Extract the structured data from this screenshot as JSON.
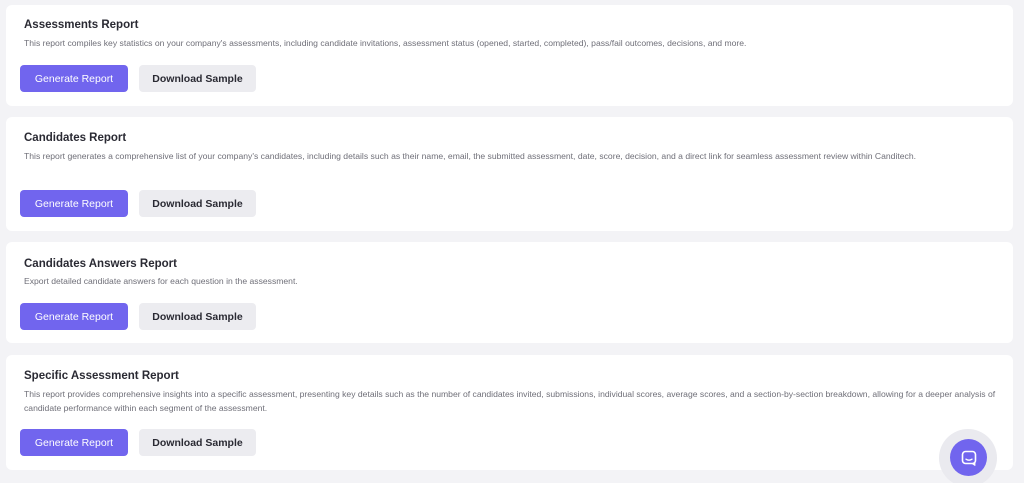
{
  "reports": [
    {
      "title": "Assessments Report",
      "description": "This report compiles key statistics on your company's assessments, including candidate invitations, assessment status (opened, started, completed), pass/fail outcomes, decisions, and more.",
      "generate_label": "Generate Report",
      "download_label": "Download Sample"
    },
    {
      "title": "Candidates Report",
      "description": "This report generates a comprehensive list of your company's candidates, including details such as their name, email, the submitted assessment, date, score, decision, and a direct link for seamless assessment review within Canditech.",
      "generate_label": "Generate Report",
      "download_label": "Download Sample"
    },
    {
      "title": "Candidates Answers Report",
      "description": "Export detailed candidate answers for each question in the assessment.",
      "generate_label": "Generate Report",
      "download_label": "Download Sample"
    },
    {
      "title": "Specific Assessment Report",
      "description": "This report provides comprehensive insights into a specific assessment, presenting key details such as the number of candidates invited, submissions, individual scores, average scores, and a section-by-section breakdown, allowing for a deeper analysis of candidate performance within each segment of the assessment.",
      "generate_label": "Generate Report",
      "download_label": "Download Sample"
    }
  ],
  "chat_widget": {
    "icon": "chat-icon",
    "color": "#7165ee"
  },
  "colors": {
    "primary": "#7165ee",
    "secondary_button": "#ececf0",
    "background": "#f3f3f6"
  }
}
